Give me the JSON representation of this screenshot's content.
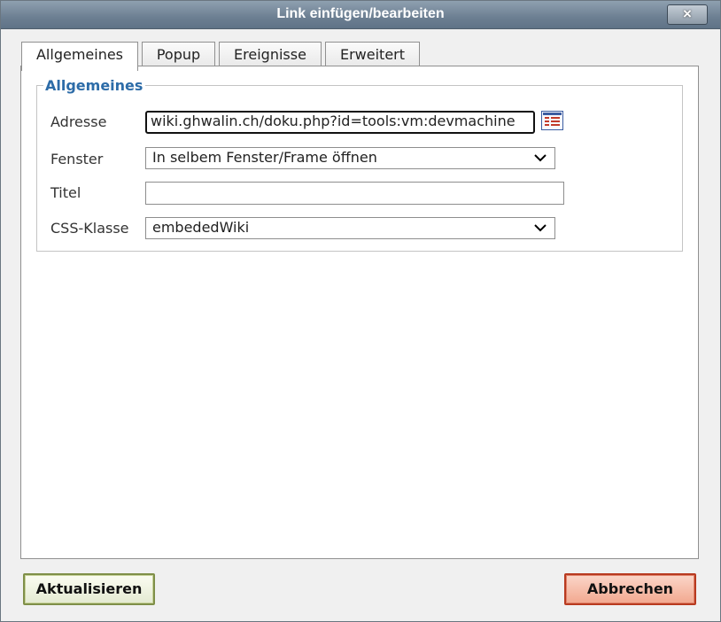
{
  "dialog": {
    "title": "Link einfügen/bearbeiten",
    "close_label": "×"
  },
  "tabs": [
    {
      "label": "Allgemeines",
      "active": true
    },
    {
      "label": "Popup",
      "active": false
    },
    {
      "label": "Ereignisse",
      "active": false
    },
    {
      "label": "Erweitert",
      "active": false
    }
  ],
  "general": {
    "legend": "Allgemeines",
    "address_label": "Adresse",
    "address_value": "wiki.ghwalin.ch/doku.php?id=tools:vm:devmachine",
    "window_label": "Fenster",
    "window_value": "In selbem Fenster/Frame öffnen",
    "title_label": "Titel",
    "title_value": "",
    "css_label": "CSS-Klasse",
    "css_value": "embededWiki"
  },
  "icons": {
    "browse": "browse-icon",
    "close": "close-icon",
    "dropdown": "chevron-down-icon"
  },
  "buttons": {
    "update_label": "Aktualisieren",
    "cancel_label": "Abbrechen"
  }
}
